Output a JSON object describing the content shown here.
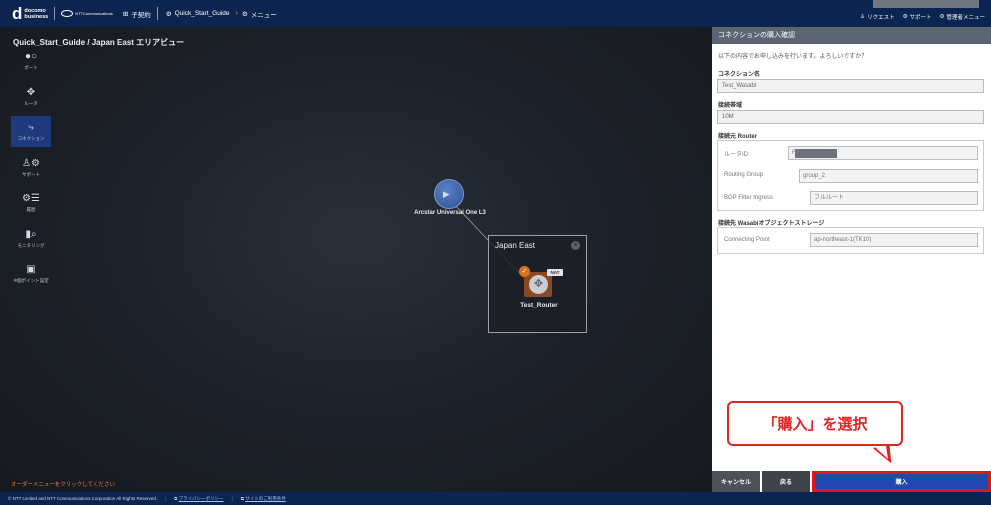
{
  "header": {
    "brand_main": "d",
    "brand_line1": "docomo",
    "brand_line2": "business",
    "ntt_text": "NTTCommunications",
    "contract": "子契約",
    "project": "Quick_Start_Guide",
    "menu": "メニュー",
    "request": "リクエスト",
    "support": "サポート",
    "admin_menu": "管理者メニュー"
  },
  "canvas": {
    "title": "Quick_Start_Guide / Japan East エリアビュー",
    "bottom_hint": "オーダーメニューをクリックしてください"
  },
  "toolbar": {
    "items": [
      {
        "label": "ポート",
        "icon": "port-icon"
      },
      {
        "label": "ルータ",
        "icon": "router-icon"
      },
      {
        "label": "コネクション",
        "icon": "connection-icon"
      },
      {
        "label": "サポート",
        "icon": "support-icon"
      },
      {
        "label": "履歴",
        "icon": "history-icon"
      },
      {
        "label": "モニタリング",
        "icon": "monitoring-icon"
      },
      {
        "label": "※個ポイント設定",
        "icon": "point-settings-icon"
      }
    ],
    "active_index": 2
  },
  "topology": {
    "cloud_label": "Arcstar Universal One L3",
    "area_name": "Japan East",
    "router_name": "Test_Router",
    "nat_badge": "NAT"
  },
  "panel": {
    "header": "コネクションの購入確認",
    "intro": "以下の内容でお申し込みを行います。よろしいですか？",
    "connection_name_label": "コネクション名",
    "connection_name": "Test_Wasabi",
    "bandwidth_label": "接続帯域",
    "bandwidth": "10M",
    "router_section": "接続元 Router",
    "router_id_label": "ルータID",
    "router_id_prefix": "F",
    "routing_group_label": "Routing Group",
    "routing_group": "group_2",
    "bgp_filter_label": "BGP Filter Ingress",
    "bgp_filter": "フルルート",
    "storage_section": "接続先 Wasabiオブジェクトストレージ",
    "connecting_point_label": "Connecting Point",
    "connecting_point": "ap-northeast-1(TK10)",
    "cancel": "キャンセル",
    "back": "戻る",
    "buy": "購入"
  },
  "callout": {
    "text": "「購入」を選択"
  },
  "footer": {
    "copyright": "© NTT Limited and NTT Communications Corporation All Rights Reserved.",
    "privacy": "プライバシーポリシー",
    "terms": "サイトのご利用条件"
  }
}
